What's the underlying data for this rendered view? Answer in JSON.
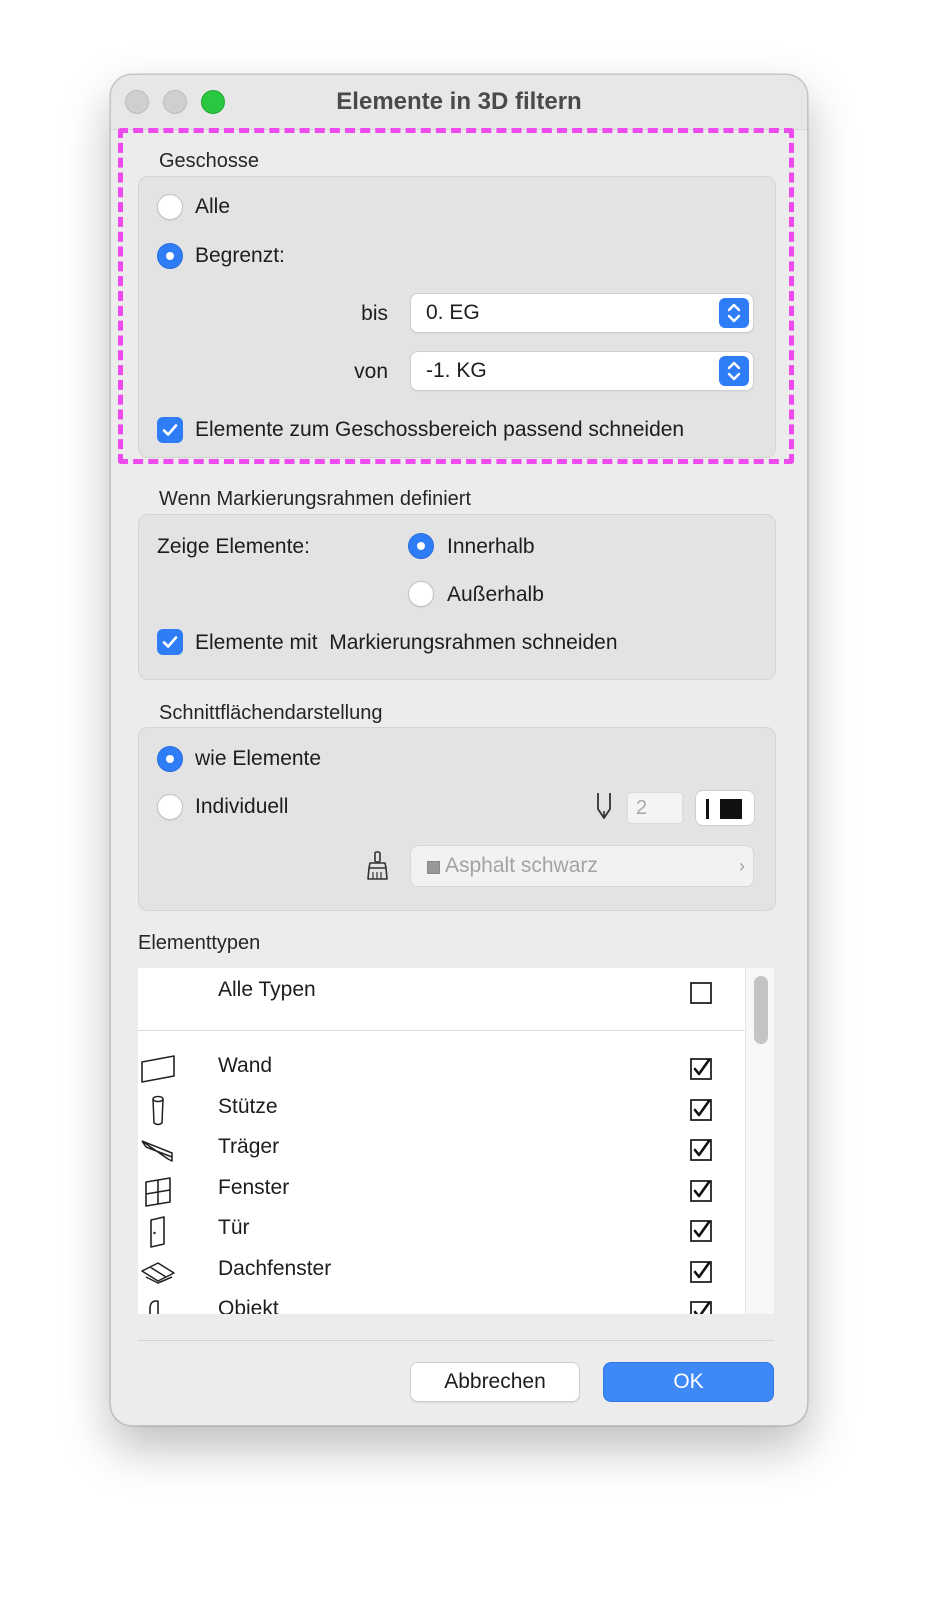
{
  "window": {
    "title": "Elemente in 3D filtern"
  },
  "floors": {
    "label": "Geschosse",
    "option_all": "Alle",
    "option_limited": "Begrenzt:",
    "to_label": "bis",
    "to_value": "0. EG",
    "from_label": "von",
    "from_value": "-1. KG",
    "cut_label": "Elemente zum Geschossbereich passend schneiden",
    "selected": "limited",
    "cut_checked": true
  },
  "marquee": {
    "label": "Wenn Markierungsrahmen definiert",
    "show_label": "Zeige Elemente:",
    "inside": "Innerhalb",
    "outside": "Außerhalb",
    "cut_label": "Elemente mit  Markierungsrahmen schneiden",
    "selected": "inside",
    "cut_checked": true
  },
  "cut_surfaces": {
    "label": "Schnittflächendarstellung",
    "option_elements": "wie Elemente",
    "option_custom": "Individuell",
    "pen_value": "2",
    "fill_value": "Asphalt schwarz",
    "selected": "elements"
  },
  "element_types": {
    "label": "Elementtypen",
    "all_label": "Alle Typen",
    "all_checked": false,
    "items": [
      {
        "label": "Wand",
        "icon": "wall-icon",
        "checked": true
      },
      {
        "label": "Stütze",
        "icon": "column-icon",
        "checked": true
      },
      {
        "label": "Träger",
        "icon": "beam-icon",
        "checked": true
      },
      {
        "label": "Fenster",
        "icon": "window-icon",
        "checked": true
      },
      {
        "label": "Tür",
        "icon": "door-icon",
        "checked": true
      },
      {
        "label": "Dachfenster",
        "icon": "skylight-icon",
        "checked": true
      },
      {
        "label": "Objekt",
        "icon": "object-icon",
        "checked": true
      }
    ]
  },
  "buttons": {
    "cancel": "Abbrechen",
    "ok": "OK"
  },
  "colors": {
    "accent": "#2f7df6",
    "highlight": "#ee4bee"
  }
}
